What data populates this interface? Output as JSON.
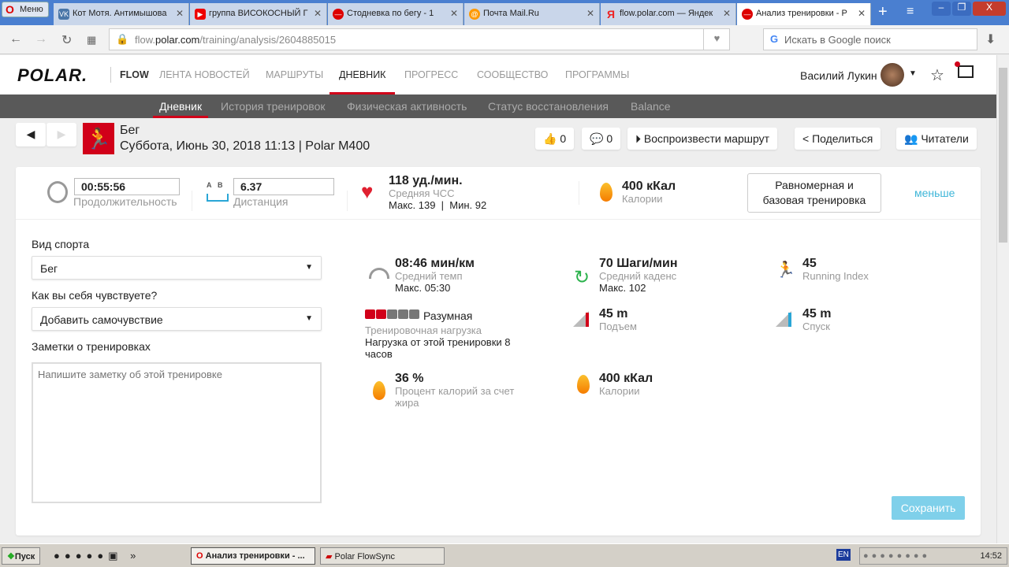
{
  "browser": {
    "menu": "Меню",
    "tabs": [
      {
        "label": "Кот Мотя. Антимышова",
        "icon": "vk-icon",
        "color": "#4a76a8"
      },
      {
        "label": "группа ВИСОКОСНЫЙ Г",
        "icon": "youtube-icon",
        "color": "#e00"
      },
      {
        "label": "Стодневка по бегу - 1",
        "icon": "opera-icon",
        "color": "#d00"
      },
      {
        "label": "Почта Mail.Ru",
        "icon": "mail-icon",
        "color": "#f90"
      },
      {
        "label": "flow.polar.com — Яндек",
        "icon": "yandex-icon",
        "color": "#e22"
      },
      {
        "label": "Анализ тренировки - Р",
        "icon": "opera-icon",
        "color": "#d00"
      }
    ],
    "url_prefix": "flow.",
    "url_domain": "polar.com",
    "url_path": "/training/analysis/2604885015",
    "search_placeholder": "Искать в Google поиск"
  },
  "header": {
    "logo": "POLAR.",
    "flow": "FLOW",
    "nav": [
      "ЛЕНТА НОВОСТЕЙ",
      "МАРШРУТЫ",
      "ДНЕВНИК",
      "ПРОГРЕСС",
      "СООБЩЕСТВО",
      "ПРОГРАММЫ"
    ],
    "user": "Василий Лукин"
  },
  "subnav": [
    "Дневник",
    "История тренировок",
    "Физическая активность",
    "Статус восстановления",
    "Balance"
  ],
  "training": {
    "sport": "Бег",
    "subtitle": "Суббота, Июнь 30, 2018 11:13 | Polar M400",
    "likes": "0",
    "comments": "0",
    "play_route": "Воспроизвести маршрут",
    "share": "Поделиться",
    "followers": "Читатели"
  },
  "summary": {
    "duration": "00:55:56",
    "duration_label": "Продолжительность",
    "ab_a": "A",
    "ab_b": "B",
    "distance": "6.37",
    "distance_label": "Дистанция",
    "hr": "118 уд./мин.",
    "hr_label": "Средняя ЧСС",
    "hr_minmax": "Макс. 139  |  Мин. 92",
    "calories": "400 кКал",
    "calories_label": "Калории",
    "benefit": "Равномерная и базовая тренировка",
    "less": "меньше"
  },
  "form": {
    "sport_label": "Вид спорта",
    "sport_value": "Бег",
    "feeling_label": "Как вы себя чувствуете?",
    "feeling_value": "Добавить самочувствие",
    "notes_label": "Заметки о тренировках",
    "notes_placeholder": "Напишите заметку об этой тренировке",
    "save": "Сохранить"
  },
  "stats": {
    "pace": "08:46 мин/км",
    "pace_label": "Средний темп",
    "pace_max": "Макс. 05:30",
    "cadence": "70 Шаги/мин",
    "cadence_label": "Средний каденс",
    "cadence_max": "Макс. 102",
    "ri": "45",
    "ri_label": "Running Index",
    "load": "Разумная",
    "load_level": 2,
    "load_max": 5,
    "load_label": "Тренировочная нагрузка",
    "load_text": "Нагрузка от этой тренировки 8 часов",
    "ascent": "45 m",
    "ascent_label": "Подъем",
    "descent": "45 m",
    "descent_label": "Спуск",
    "fat": "36 %",
    "fat_label": "Процент калорий за счет жира",
    "cal": "400 кКал",
    "cal_label": "Калории"
  },
  "taskbar": {
    "start": "Пуск",
    "items": [
      "Анализ тренировки - ...",
      "Polar FlowSync"
    ],
    "lang": "EN",
    "time": "14:52"
  },
  "colors": {
    "accent": "#d10019",
    "link": "#3fb6d8",
    "save": "#7fd0ea"
  }
}
